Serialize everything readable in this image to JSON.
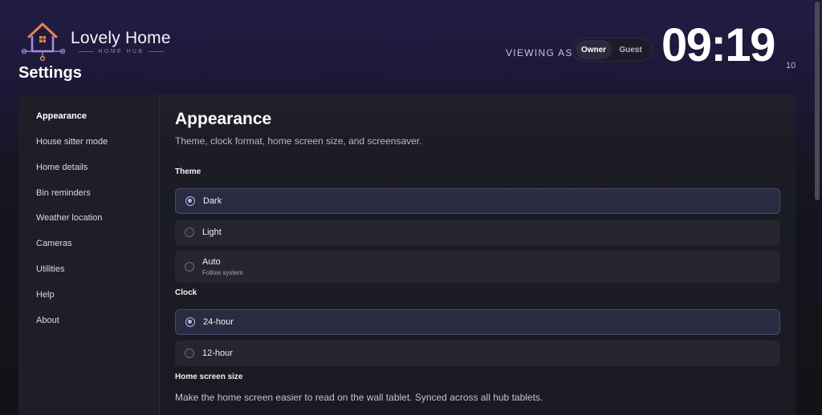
{
  "brand": {
    "name": "Lovely Home",
    "subtitle": "HOME HUB"
  },
  "page_title": "Settings",
  "viewing": {
    "label": "VIEWING AS",
    "options": [
      "Owner",
      "Guest"
    ],
    "selected": "Owner"
  },
  "clock": {
    "time": "09:19",
    "seconds": "10"
  },
  "sidebar": {
    "items": [
      {
        "label": "Appearance",
        "active": true
      },
      {
        "label": "House sitter mode"
      },
      {
        "label": "Home details"
      },
      {
        "label": "Bin reminders"
      },
      {
        "label": "Weather location"
      },
      {
        "label": "Cameras"
      },
      {
        "label": "Utilities"
      },
      {
        "label": "Help"
      },
      {
        "label": "About"
      }
    ]
  },
  "section": {
    "title": "Appearance",
    "description": "Theme, clock format, home screen size, and screensaver."
  },
  "theme": {
    "label": "Theme",
    "options": [
      {
        "label": "Dark",
        "selected": true
      },
      {
        "label": "Light"
      },
      {
        "label": "Auto",
        "sub": "Follow system"
      }
    ]
  },
  "clock_format": {
    "label": "Clock",
    "options": [
      {
        "label": "24-hour",
        "selected": true
      },
      {
        "label": "12-hour"
      }
    ]
  },
  "home_screen_size": {
    "label": "Home screen size",
    "description": "Make the home screen easier to read on the wall tablet. Synced across all hub tablets."
  },
  "colors": {
    "accent": "#a9bde8",
    "logo_orange": "#e0874a",
    "logo_purple": "#8a76d8",
    "background_top": "#221c44",
    "panel": "#1b1c25"
  }
}
